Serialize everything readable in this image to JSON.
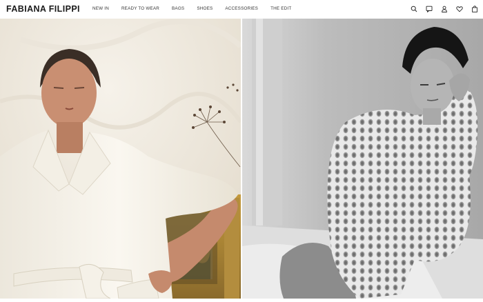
{
  "header": {
    "logo": "FABIANA FILIPPI",
    "nav": [
      {
        "label": "NEW IN"
      },
      {
        "label": "READY TO WEAR"
      },
      {
        "label": "BAGS"
      },
      {
        "label": "SHOES"
      },
      {
        "label": "ACCESSORIES"
      },
      {
        "label": "THE EDIT"
      }
    ],
    "icons": [
      "search-icon",
      "chat-icon",
      "account-icon",
      "wishlist-icon",
      "bag-icon"
    ]
  },
  "hero": {
    "left_image": "model-in-white-wrap-coat",
    "right_image": "model-in-knit-sweater-black-and-white"
  },
  "colors": {
    "background": "#ffffff",
    "text": "#222222",
    "left_wall": "#efe9de",
    "coat": "#f7f4ec"
  }
}
